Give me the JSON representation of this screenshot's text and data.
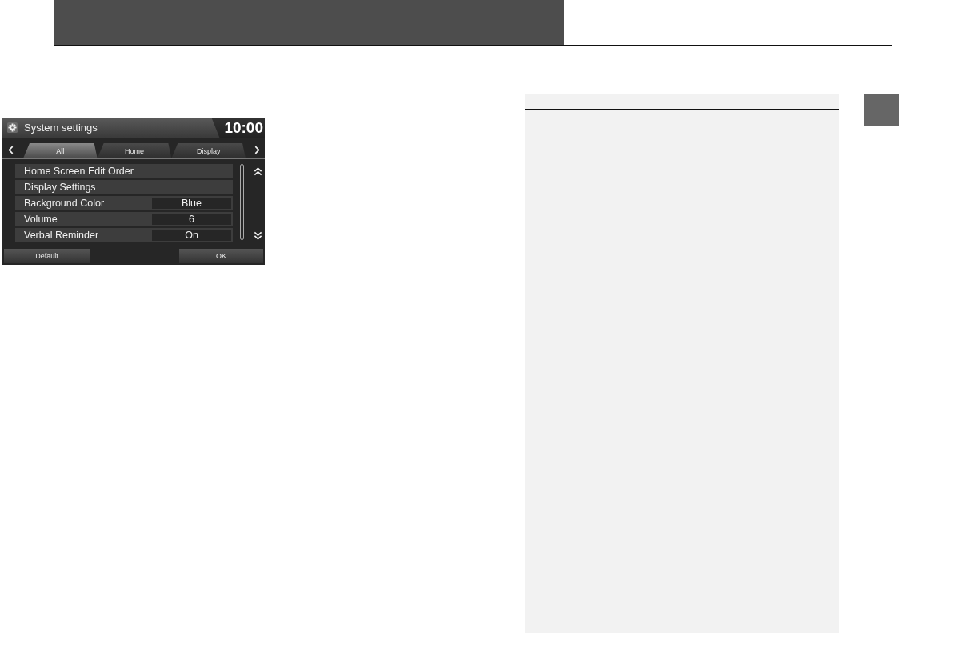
{
  "screen": {
    "title": "System settings",
    "time": "10:00",
    "tabs": [
      {
        "label": "All",
        "selected": true
      },
      {
        "label": "Home",
        "selected": false
      },
      {
        "label": "Display",
        "selected": false
      }
    ],
    "rows": [
      {
        "label": "Home Screen Edit Order"
      },
      {
        "label": "Display Settings"
      },
      {
        "label": "Background Color",
        "value": "Blue"
      },
      {
        "label": "Volume",
        "value": "6"
      },
      {
        "label": "Verbal Reminder",
        "value": "On"
      }
    ],
    "buttons": [
      "Default",
      "OK"
    ]
  }
}
